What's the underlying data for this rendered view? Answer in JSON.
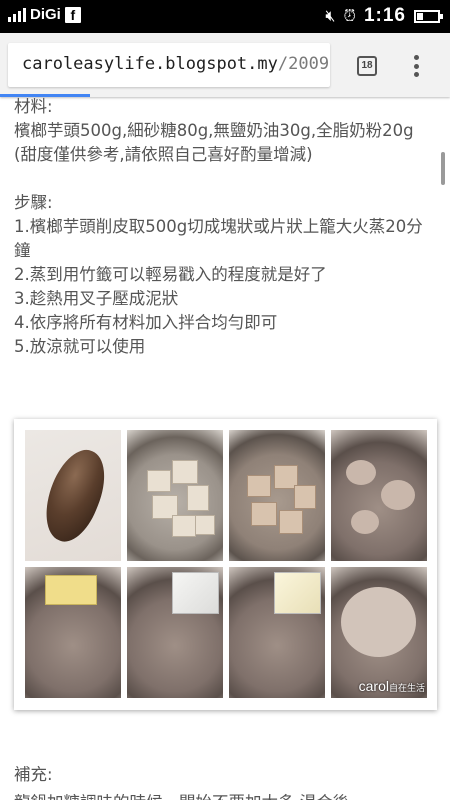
{
  "status_bar": {
    "carrier": "DiGi",
    "time": "1:16",
    "battery_level": 0.3,
    "icons": [
      "signal-icon",
      "facebook-icon",
      "mute-icon",
      "alarm-icon",
      "battery-icon"
    ]
  },
  "browser": {
    "url_domain": "caroleasylife.blogspot.my",
    "url_path": "/2009",
    "tab_count": "18",
    "accent_color": "#4285f4"
  },
  "article": {
    "ingredients_heading": "材料:",
    "ingredients": "檳榔芋頭500g,細砂糖80g,無鹽奶油30g,全脂奶粉20g",
    "sweetness_note": "(甜度僅供參考,請依照自己喜好酌量增減)",
    "steps_heading": "步驟:",
    "steps": [
      "1.檳榔芋頭削皮取500g切成塊狀或片狀上籠大火蒸20分鐘",
      "2.蒸到用竹籤可以輕易戳入的程度就是好了",
      "3.趁熱用叉子壓成泥狀",
      "4.依序將所有材料加入拌合均勻即可",
      "5.放涼就可以使用"
    ],
    "photo_watermark": "carol",
    "photo_watermark_small": "自在生活",
    "supplement_heading": "補充:",
    "supplement_cut": "龍鍋加糖調味的時候，開始不要加太多 湯合後"
  }
}
